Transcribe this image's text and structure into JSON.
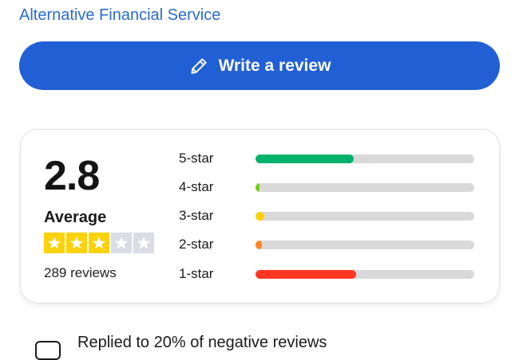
{
  "header": {
    "category_link": "Alternative Financial Service"
  },
  "actions": {
    "write_review_label": "Write a review",
    "write_review_icon": "pencil-icon",
    "button_color": "#215fd5"
  },
  "rating_summary": {
    "score": "2.8",
    "average_label": "Average",
    "stars_filled": 3,
    "stars_total": 5,
    "review_count": "289 reviews",
    "star_filled_color": "#fdd10b",
    "star_empty_color": "#dcdce6"
  },
  "distribution": [
    {
      "label": "5-star",
      "fraction": 0.45,
      "color": "#04b26c"
    },
    {
      "label": "4-star",
      "fraction": 0.02,
      "color": "#73cf11"
    },
    {
      "label": "3-star",
      "fraction": 0.04,
      "color": "#fdd10b"
    },
    {
      "label": "2-star",
      "fraction": 0.03,
      "color": "#ff8622"
    },
    {
      "label": "1-star",
      "fraction": 0.46,
      "color": "#ff3722"
    }
  ],
  "reply_info": {
    "text": "Replied to 20% of negative reviews",
    "icon": "chat-bubble-icon"
  }
}
